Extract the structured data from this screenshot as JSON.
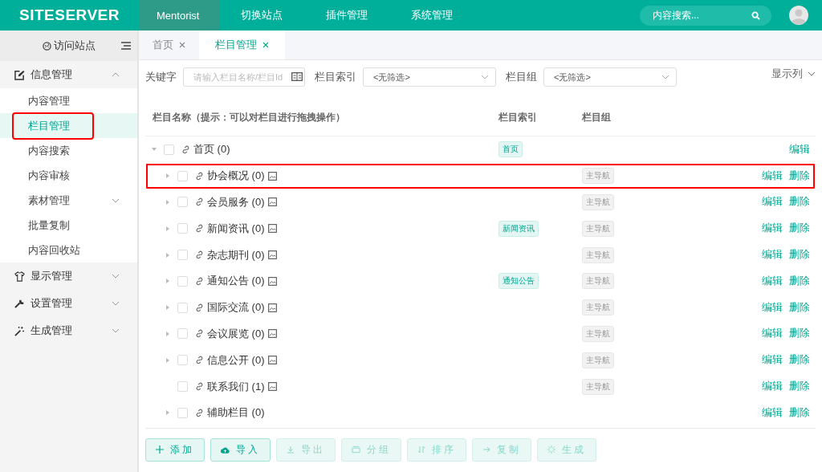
{
  "header": {
    "logo": "SITESERVER",
    "nav": [
      {
        "label": "Mentorist",
        "selected": true
      },
      {
        "label": "切换站点",
        "selected": false
      },
      {
        "label": "插件管理",
        "selected": false
      },
      {
        "label": "系统管理",
        "selected": false
      }
    ],
    "search": {
      "placeholder": "内容搜索..."
    }
  },
  "sidebar": {
    "visit": "访问站点",
    "groups": [
      {
        "label": "信息管理",
        "kind": "edit",
        "expanded": true,
        "items": [
          {
            "label": "内容管理",
            "selected": false,
            "highlighted": false,
            "has_submenu": false
          },
          {
            "label": "栏目管理",
            "selected": true,
            "highlighted": true,
            "has_submenu": false
          },
          {
            "label": "内容搜索",
            "selected": false,
            "highlighted": false,
            "has_submenu": false
          },
          {
            "label": "内容审核",
            "selected": false,
            "highlighted": false,
            "has_submenu": false
          },
          {
            "label": "素材管理",
            "selected": false,
            "highlighted": false,
            "has_submenu": true
          },
          {
            "label": "批量复制",
            "selected": false,
            "highlighted": false,
            "has_submenu": false
          },
          {
            "label": "内容回收站",
            "selected": false,
            "highlighted": false,
            "has_submenu": false
          }
        ]
      },
      {
        "label": "显示管理",
        "kind": "shirt",
        "expanded": false
      },
      {
        "label": "设置管理",
        "kind": "wrench",
        "expanded": false
      },
      {
        "label": "生成管理",
        "kind": "magic",
        "expanded": false
      }
    ]
  },
  "tabs": [
    {
      "label": "首页",
      "selected": false
    },
    {
      "label": "栏目管理",
      "selected": true
    }
  ],
  "filters": {
    "keyword_label": "关键字",
    "keyword_placeholder": "请输入栏目名称/栏目Id",
    "index_label": "栏目索引",
    "index_value": "<无筛选>",
    "group_label": "栏目组",
    "group_value": "<无筛选>",
    "columns_menu": "显示列"
  },
  "table": {
    "columns": [
      "栏目名称（提示：可以对栏目进行拖拽操作）",
      "栏目索引",
      "栏目组"
    ],
    "rows": [
      {
        "name": "首页 (0)",
        "expandable": true,
        "expanded": true,
        "checked": false,
        "has_image": false,
        "highlighted": false,
        "index": "首页",
        "actions": [
          "编辑"
        ],
        "children": [
          {
            "name": "协会概况 (0)",
            "expandable": true,
            "checked": false,
            "has_image": true,
            "highlighted": true,
            "group": "主导航",
            "actions": [
              "编辑",
              "删除"
            ]
          },
          {
            "name": "会员服务 (0)",
            "expandable": true,
            "checked": false,
            "has_image": true,
            "highlighted": false,
            "group": "主导航",
            "actions": [
              "编辑",
              "删除"
            ]
          },
          {
            "name": "新闻资讯 (0)",
            "expandable": true,
            "checked": false,
            "has_image": true,
            "highlighted": false,
            "index": "新闻资讯",
            "group": "主导航",
            "actions": [
              "编辑",
              "删除"
            ]
          },
          {
            "name": "杂志期刊 (0)",
            "expandable": true,
            "checked": false,
            "has_image": true,
            "highlighted": false,
            "group": "主导航",
            "actions": [
              "编辑",
              "删除"
            ]
          },
          {
            "name": "通知公告 (0)",
            "expandable": true,
            "checked": false,
            "has_image": true,
            "highlighted": false,
            "index": "通知公告",
            "group": "主导航",
            "actions": [
              "编辑",
              "删除"
            ]
          },
          {
            "name": "国际交流 (0)",
            "expandable": true,
            "checked": false,
            "has_image": true,
            "highlighted": false,
            "group": "主导航",
            "actions": [
              "编辑",
              "删除"
            ]
          },
          {
            "name": "会议展览 (0)",
            "expandable": true,
            "checked": false,
            "has_image": true,
            "highlighted": false,
            "group": "主导航",
            "actions": [
              "编辑",
              "删除"
            ]
          },
          {
            "name": "信息公开 (0)",
            "expandable": true,
            "checked": false,
            "has_image": true,
            "highlighted": false,
            "group": "主导航",
            "actions": [
              "编辑",
              "删除"
            ]
          },
          {
            "name": "联系我们 (1)",
            "expandable": false,
            "checked": false,
            "has_image": true,
            "highlighted": false,
            "group": "主导航",
            "actions": [
              "编辑",
              "删除"
            ]
          },
          {
            "name": "辅助栏目 (0)",
            "expandable": true,
            "checked": false,
            "has_image": false,
            "highlighted": false,
            "actions": [
              "编辑",
              "删除"
            ]
          }
        ]
      }
    ]
  },
  "buttons": [
    {
      "label": "添加",
      "kind": "plus",
      "disabled": false
    },
    {
      "label": "导入",
      "kind": "cloud",
      "disabled": false
    },
    {
      "label": "导出",
      "kind": "download",
      "disabled": true
    },
    {
      "label": "分组",
      "kind": "folder",
      "disabled": true
    },
    {
      "label": "排序",
      "kind": "sort",
      "disabled": true
    },
    {
      "label": "复制",
      "kind": "arrow",
      "disabled": true
    },
    {
      "label": "生成",
      "kind": "spark",
      "disabled": true
    }
  ]
}
